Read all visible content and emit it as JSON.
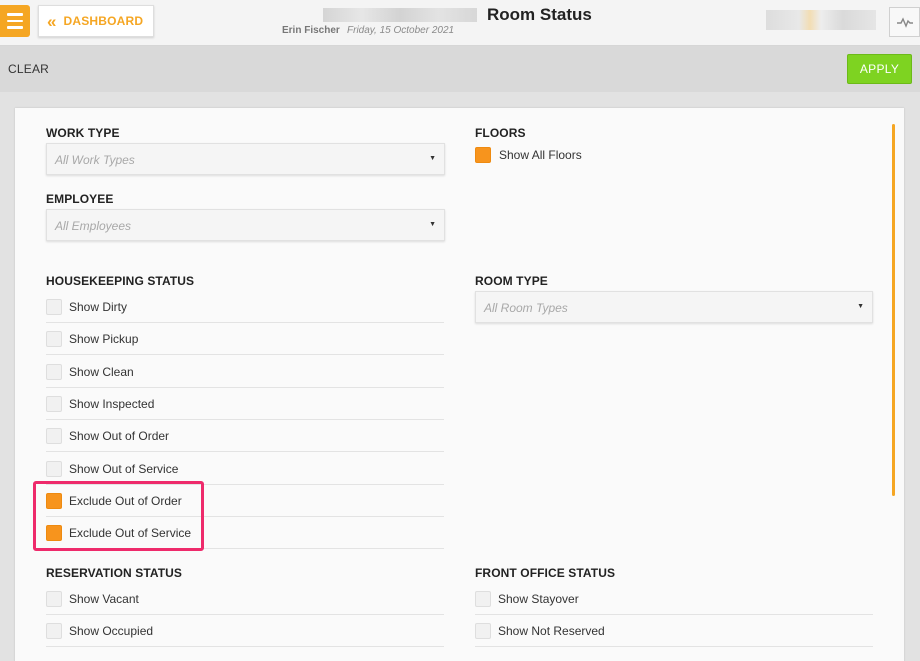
{
  "header": {
    "dashboard_label": "DASHBOARD",
    "title": "Room Status",
    "user_name": "Erin Fischer",
    "date": "Friday, 15 October 2021"
  },
  "actions": {
    "clear_label": "CLEAR",
    "apply_label": "APPLY"
  },
  "filters": {
    "work_type": {
      "label": "WORK TYPE",
      "placeholder": "All Work Types"
    },
    "employee": {
      "label": "EMPLOYEE",
      "placeholder": "All Employees"
    },
    "floors": {
      "label": "FLOORS",
      "option": "Show All Floors",
      "checked": true
    },
    "room_type": {
      "label": "ROOM TYPE",
      "placeholder": "All Room Types"
    },
    "housekeeping": {
      "label": "HOUSEKEEPING STATUS",
      "items": [
        {
          "label": "Show Dirty",
          "checked": false
        },
        {
          "label": "Show Pickup",
          "checked": false
        },
        {
          "label": "Show Clean",
          "checked": false
        },
        {
          "label": "Show Inspected",
          "checked": false
        },
        {
          "label": "Show Out of Order",
          "checked": false
        },
        {
          "label": "Show Out of Service",
          "checked": false
        },
        {
          "label": "Exclude Out of Order",
          "checked": true
        },
        {
          "label": "Exclude Out of Service",
          "checked": true
        }
      ]
    },
    "reservation": {
      "label": "RESERVATION STATUS",
      "items": [
        {
          "label": "Show Vacant",
          "checked": false
        },
        {
          "label": "Show Occupied",
          "checked": false
        }
      ]
    },
    "front_office": {
      "label": "FRONT OFFICE STATUS",
      "items": [
        {
          "label": "Show Stayover",
          "checked": false
        },
        {
          "label": "Show Not Reserved",
          "checked": false
        }
      ]
    }
  },
  "colors": {
    "accent": "#f5a623",
    "checkbox_checked": "#f7941d",
    "apply_green": "#7ed321",
    "highlight": "#ee2a6b"
  }
}
